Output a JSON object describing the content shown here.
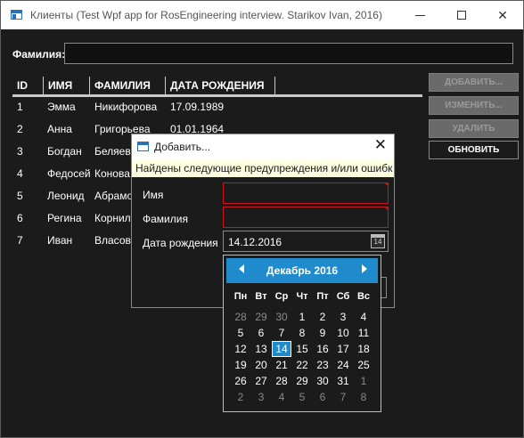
{
  "window": {
    "title": "Клиенты (Test Wpf app for RosEngineering interview. Starikov Ivan, 2016)",
    "controls": [
      "minimize",
      "maximize",
      "close"
    ]
  },
  "filter": {
    "label": "Фамилия:",
    "value": ""
  },
  "grid": {
    "columns": [
      "ID",
      "ИМЯ",
      "ФАМИЛИЯ",
      "ДАТА РОЖДЕНИЯ"
    ],
    "rows": [
      [
        "1",
        "Эмма",
        "Никифорова",
        "17.09.1989"
      ],
      [
        "2",
        "Анна",
        "Григорьева",
        "01.01.1964"
      ],
      [
        "3",
        "Богдан",
        "Беляев",
        ""
      ],
      [
        "4",
        "Федосей",
        "Конова",
        ""
      ],
      [
        "5",
        "Леонид",
        "Абрамо",
        ""
      ],
      [
        "6",
        "Регина",
        "Корнил",
        ""
      ],
      [
        "7",
        "Иван",
        "Власов",
        ""
      ]
    ]
  },
  "buttons": {
    "add": "ДОБАВИТЬ...",
    "edit": "ИЗМЕНИТЬ...",
    "delete": "УДАЛИТЬ",
    "refresh": "ОБНОВИТЬ"
  },
  "dialog": {
    "title": "Добавить...",
    "warning": "Найдены следующие предупреждения и/или ошибк",
    "first_name_label": "Имя",
    "last_name_label": "Фамилия",
    "birthdate_label": "Дата рождения",
    "first_name_value": "",
    "last_name_value": "",
    "birthdate_value": "14.12.2016",
    "calendar_icon_text": "14"
  },
  "calendar": {
    "month_title": "Декабрь 2016",
    "weekdays": [
      "Пн",
      "Вт",
      "Ср",
      "Чт",
      "Пт",
      "Сб",
      "Вс"
    ],
    "weeks": [
      [
        "28",
        "29",
        "30",
        "1",
        "2",
        "3",
        "4"
      ],
      [
        "5",
        "6",
        "7",
        "8",
        "9",
        "10",
        "11"
      ],
      [
        "12",
        "13",
        "14",
        "15",
        "16",
        "17",
        "18"
      ],
      [
        "19",
        "20",
        "21",
        "22",
        "23",
        "24",
        "25"
      ],
      [
        "26",
        "27",
        "28",
        "29",
        "30",
        "31",
        "1"
      ],
      [
        "2",
        "3",
        "4",
        "5",
        "6",
        "7",
        "8"
      ]
    ],
    "selected": "14",
    "colors": {
      "accent": "#1f8bcd",
      "other_month": "#8a8a8a",
      "error": "#c8151b"
    }
  }
}
